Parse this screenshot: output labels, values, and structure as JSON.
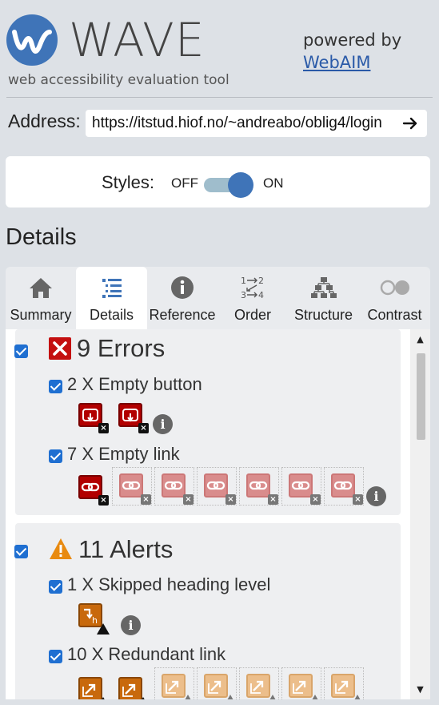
{
  "brand": {
    "logo_text": "WAVE",
    "tagline": "web accessibility evaluation tool",
    "powered_by": "powered by",
    "webaim_link": "WebAIM"
  },
  "address": {
    "label": "Address:",
    "value": "https://itstud.hiof.no/~andreabo/oblig4/login"
  },
  "styles": {
    "label": "Styles:",
    "off": "OFF",
    "on": "ON",
    "state": "on"
  },
  "section_title": "Details",
  "tabs": [
    {
      "label": "Summary",
      "icon": "home-icon"
    },
    {
      "label": "Details",
      "icon": "list-icon",
      "active": true
    },
    {
      "label": "Reference",
      "icon": "info-icon"
    },
    {
      "label": "Order",
      "icon": "order-icon"
    },
    {
      "label": "Structure",
      "icon": "structure-icon"
    },
    {
      "label": "Contrast",
      "icon": "contrast-icon"
    }
  ],
  "errors": {
    "title": "9 Errors",
    "items": [
      {
        "label": "2 X Empty button",
        "count": 2
      },
      {
        "label": "7 X Empty link",
        "count": 7
      }
    ]
  },
  "alerts": {
    "title": "11 Alerts",
    "items": [
      {
        "label": "1 X Skipped heading level",
        "count": 1
      },
      {
        "label": "10 X Redundant link",
        "count": 10
      }
    ]
  },
  "colors": {
    "accent": "#3f74b8",
    "error": "#b20000",
    "alert": "#c8690c",
    "checkbox": "#1f6fd1"
  }
}
